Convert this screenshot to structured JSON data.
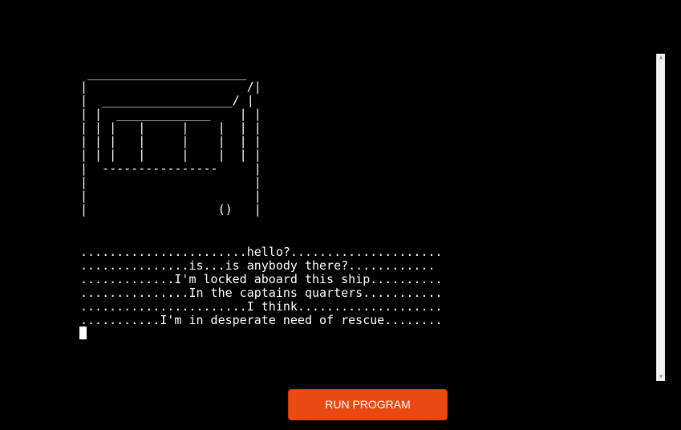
{
  "terminal": {
    "ascii_art": " ______________________\n|                      /|\n|  __________________/ |\n| |  _____________    | |\n| | |   |     |    |  | |\n| | |   |     |    |  | |\n| | |   |     |    |  | |\n|  ----------------     |\n|                       |\n|                       |\n|                  ()   |",
    "lines": [
      ".......................hello?.....................",
      "...............is...is anybody there?............",
      ".............I'm locked aboard this ship..........",
      "...............In the captains quarters...........",
      ".......................I think....................",
      "...........I'm in desperate need of rescue........"
    ]
  },
  "scrollbar": {
    "up_arrow": "▲",
    "down_arrow": "▼"
  },
  "run_button": {
    "label": "RUN PROGRAM"
  },
  "colors": {
    "background": "#000000",
    "text": "#ffffff",
    "button": "#e84a12"
  }
}
